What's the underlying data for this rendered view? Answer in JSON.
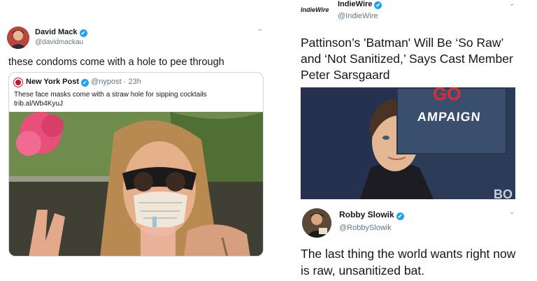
{
  "left_tweet": {
    "author_name": "David Mack",
    "author_handle": "@davidmackau",
    "text": "these condoms come with a hole to pee through",
    "quoted": {
      "author_name": "New York Post",
      "author_handle": "@nypost",
      "time": "23h",
      "text": "These face masks come with a straw hole for sipping cocktails",
      "link": "trib.al/Wb4KyuJ"
    }
  },
  "right_tweet_top": {
    "logo": "IndieWire",
    "author_name": "IndieWire",
    "author_handle": "@IndieWire",
    "headline": "Pattinson’s 'Batman' Will Be ‘So Raw’ and ‘Not Sanitized,’ Says Cast Member Peter Sarsgaard",
    "photo_sign": {
      "top": "GO",
      "main": "AMPAIGN",
      "corner": "BO"
    }
  },
  "right_tweet_reply": {
    "author_name": "Robby Slowik",
    "author_handle": "@RobbySlowik",
    "text": "The last thing the world wants right now is raw, unsanitized bat."
  },
  "icons": {
    "verified": "✔",
    "chevron": "⌄"
  },
  "colors": {
    "twitter_blue": "#1da1f2",
    "nypost_red": "#c8102e",
    "muted_text": "#657786"
  }
}
